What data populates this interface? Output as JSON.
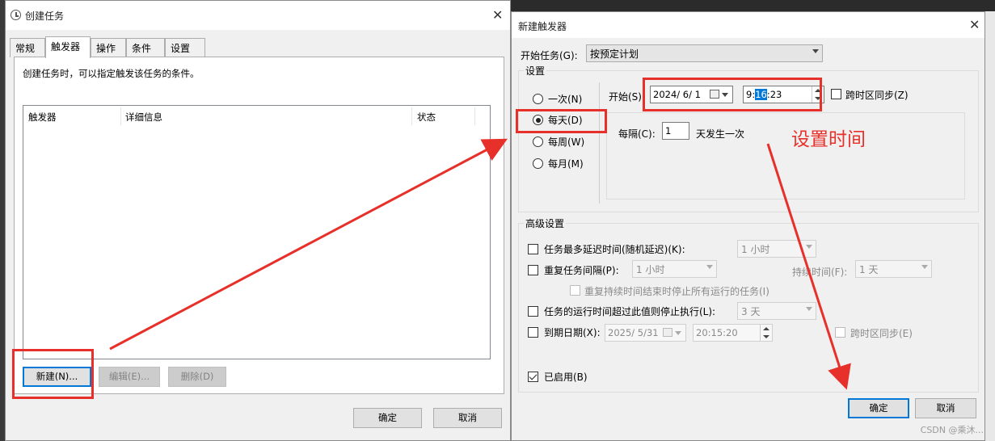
{
  "left_dialog": {
    "title": "创建任务",
    "tabs": [
      "常规",
      "触发器",
      "操作",
      "条件",
      "设置"
    ],
    "active_tab": "触发器",
    "description": "创建任务时，可以指定触发该任务的条件。",
    "columns": [
      "触发器",
      "详细信息",
      "状态"
    ],
    "buttons": {
      "new": "新建(N)...",
      "edit": "编辑(E)...",
      "delete": "删除(D)"
    },
    "ok": "确定",
    "cancel": "取消"
  },
  "right_dialog": {
    "title": "新建触发器",
    "begin_task_label": "开始任务(G):",
    "begin_task_value": "按预定计划",
    "settings_label": "设置",
    "radios": [
      "一次(N)",
      "每天(D)",
      "每周(W)",
      "每月(M)"
    ],
    "selected_radio": "每天(D)",
    "start_label": "开始(S):",
    "start_date": "2024/  6/  1",
    "start_time_h": "9:",
    "start_time_sel": "16",
    "start_time_rest": ":23",
    "sync_tz": "跨时区同步(Z)",
    "recur_label": "每隔(C):",
    "recur_value": "1",
    "recur_unit": "天发生一次",
    "advanced_label": "高级设置",
    "delay_label": "任务最多延迟时间(随机延迟)(K):",
    "delay_value": "1 小时",
    "repeat_label": "重复任务间隔(P):",
    "repeat_value": "1 小时",
    "duration_label": "持续时间(F):",
    "duration_value": "1 天",
    "stop_all_label": "重复持续时间结束时停止所有运行的任务(I)",
    "stop_if_label": "任务的运行时间超过此值则停止执行(L):",
    "stop_if_value": "3 天",
    "expire_label": "到期日期(X):",
    "expire_date": "2025/  5/31",
    "expire_time": "20:15:20",
    "expire_sync": "跨时区同步(E)",
    "enabled_label": "已启用(B)",
    "ok": "确定",
    "cancel": "取消"
  },
  "annotation": "设置时间",
  "watermark": "CSDN @乘沐...",
  "colors": {
    "annotation_red": "#e8302a",
    "focus_blue": "#0078d7"
  }
}
